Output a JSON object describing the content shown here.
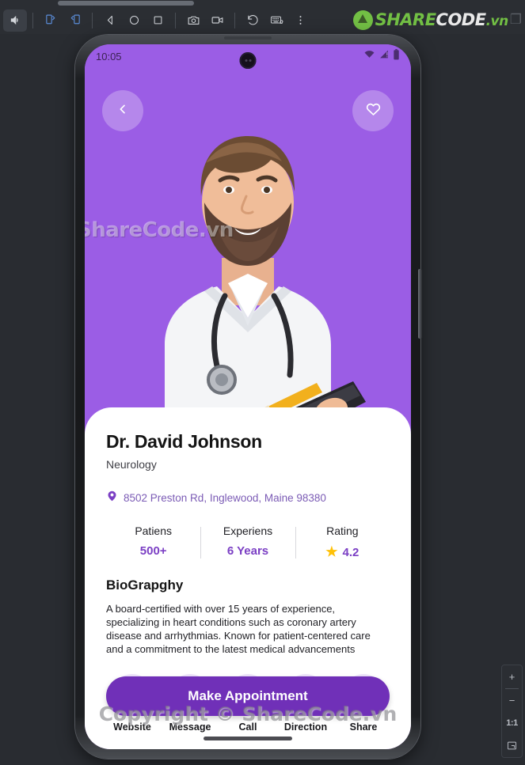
{
  "window": {
    "titlebar_name": "window-drag-handle"
  },
  "toolbar": {
    "buttons": [
      {
        "name": "volume-icon",
        "label": "Volume"
      },
      {
        "name": "rotate-left-icon",
        "label": "Rotate left"
      },
      {
        "name": "rotate-right-icon",
        "label": "Rotate right"
      },
      {
        "name": "back-nav-icon",
        "label": "Back"
      },
      {
        "name": "home-nav-icon",
        "label": "Home"
      },
      {
        "name": "recents-nav-icon",
        "label": "Recent apps"
      },
      {
        "name": "screenshot-icon",
        "label": "Screenshot"
      },
      {
        "name": "screen-record-icon",
        "label": "Record screen"
      },
      {
        "name": "restore-icon",
        "label": "Restore"
      },
      {
        "name": "keyboard-icon",
        "label": "Keyboard"
      },
      {
        "name": "more-options-icon",
        "label": "More"
      }
    ]
  },
  "branding": {
    "logo_share": "SHARE",
    "logo_code": "CODE",
    "logo_vn": ".vn",
    "logo_extra": "❐"
  },
  "zoom_panel": {
    "zoom_in": "+",
    "zoom_out": "−",
    "actual_size": "1:1",
    "fit_screen_icon": "fit-screen-icon"
  },
  "phone": {
    "status_bar": {
      "clock": "10:05",
      "icons": [
        "wifi-icon",
        "cellular-signal-icon",
        "battery-icon"
      ]
    },
    "hero": {
      "background_color": "#9b5de5",
      "back_button": "chevron-left-icon",
      "favorite_button": "heart-outline-icon",
      "watermark": "ShareCode.vn"
    },
    "card": {
      "doctor_name": "Dr. David Johnson",
      "specialty": "Neurology",
      "address": "8502 Preston Rd, Inglewood, Maine 98380",
      "address_icon": "location-pin-icon",
      "stats": [
        {
          "label": "Patiens",
          "value": "500+",
          "icon": ""
        },
        {
          "label": "Experiens",
          "value": "6 Years",
          "icon": ""
        },
        {
          "label": "Rating",
          "value": "4.2",
          "icon": "star-icon"
        }
      ],
      "bio_title": "BioGrapghy",
      "bio_text": "A board-certified with over 15 years of experience,  specializing in heart conditions such as coronary artery  disease and arrhythmias. Known for patient-centered care  and a commitment to the latest medical advancements",
      "actions": [
        {
          "label": "Website",
          "icon": "globe-www-icon"
        },
        {
          "label": "Message",
          "icon": "chat-bubble-icon"
        },
        {
          "label": "Call",
          "icon": "phone-call-icon"
        },
        {
          "label": "Direction",
          "icon": "route-direction-icon"
        },
        {
          "label": "Share",
          "icon": "share-nodes-icon"
        }
      ],
      "appointment_button": "Make Appointment",
      "watermark": "Copyright © ShareCode.vn"
    }
  },
  "colors": {
    "accent_purple": "#7030b8",
    "hero_purple": "#9b5de5",
    "icon_bg": "#ede4fa",
    "star_gold": "#FFC107",
    "brand_green": "#72bf44"
  }
}
